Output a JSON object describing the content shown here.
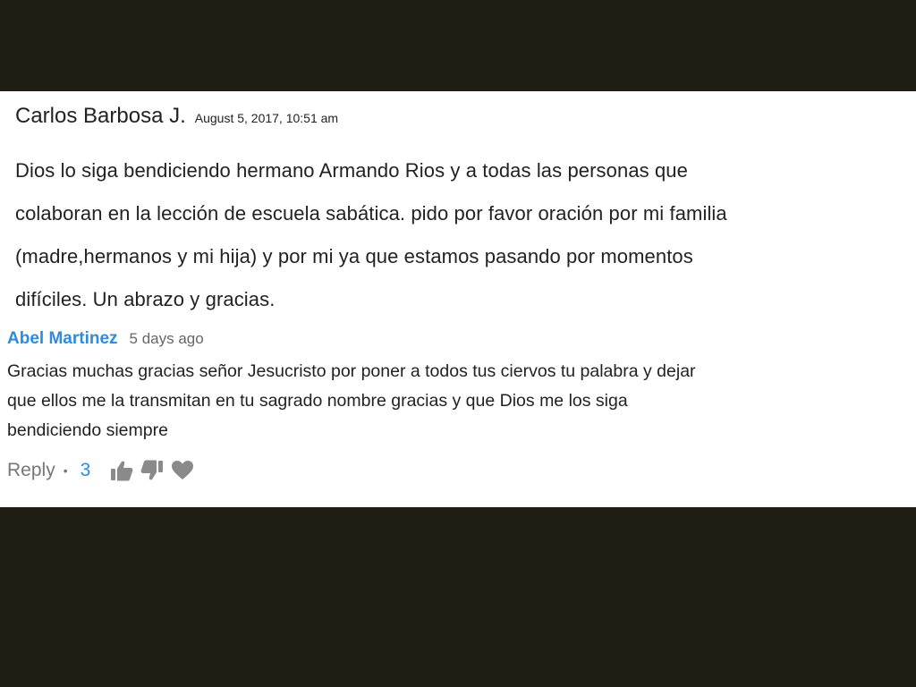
{
  "first_comment": {
    "author": "Carlos Barbosa J.",
    "date": "August 5, 2017, 10:51 am",
    "lines": [
      "Dios lo siga bendiciendo hermano Armando Rios y a todas las personas que",
      "colaboran en la lección de escuela sabática. pido por favor oración por mi familia",
      "(madre,hermanos y mi hija) y por mi ya que estamos pasando por momentos",
      "difíciles. Un abrazo y gracias."
    ]
  },
  "reply": {
    "author": "Abel Martinez",
    "time": "5 days ago",
    "lines": [
      "Gracias muchas gracias señor Jesucristo por poner a todos tus ciervos tu palabra y dejar",
      "que ellos me la transmitan en tu sagrado nombre gracias y que Dios me los siga",
      "bendiciendo siempre"
    ],
    "actions": {
      "reply_label": "Reply",
      "separator": "•",
      "vote_count": "3",
      "upvote_icon": "thumbs-up-icon",
      "downvote_icon": "thumbs-down-icon",
      "heart_icon": "heart-icon"
    }
  },
  "colors": {
    "backdrop": "#1f1d14",
    "card": "#ffffff",
    "author_link": "#2d8ce0",
    "muted": "#777777",
    "icon": "#8a8a8a"
  }
}
